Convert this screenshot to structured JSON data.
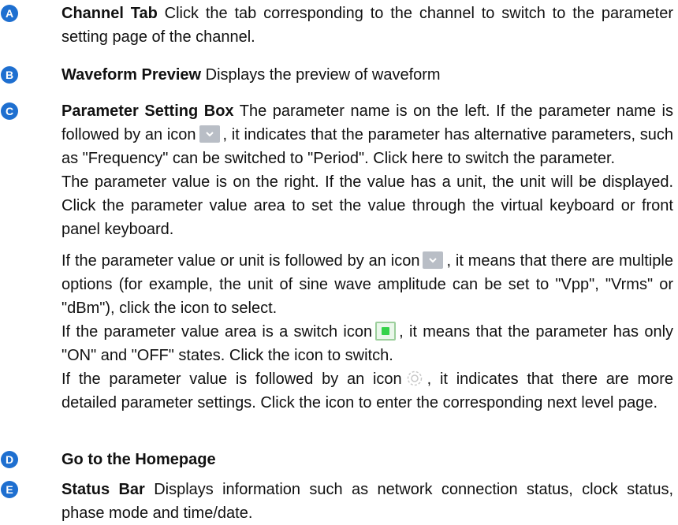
{
  "items": [
    {
      "marker": "A",
      "term": "Channel Tab",
      "text": "Click the tab corresponding to the channel to switch to the parameter setting page of the channel."
    },
    {
      "marker": "B",
      "term": "Waveform Preview",
      "text": "Displays the preview of waveform"
    },
    {
      "marker": "C",
      "term": "Parameter Setting Box",
      "text1_a": "The parameter name is on the left. If the parameter name is followed by an icon",
      "text1_b": ", it indicates that the parameter has alternative parameters, such as \"Frequency\" can be switched to \"Period\". Click here to switch the parameter.",
      "text2": "The parameter value is on the right. If the value has a unit, the unit will be displayed. Click the parameter value area to set the value through the virtual keyboard or front panel keyboard.",
      "text3_a": "If the parameter value or unit is followed by an icon",
      "text3_b": ", it means that there are multiple options (for example, the unit of sine wave amplitude can be set to \"Vpp\", \"Vrms\" or \"dBm\"), click the icon to select.",
      "text4_a": "If the parameter value area is a switch icon",
      "text4_b": ", it means that the parameter has only \"ON\" and \"OFF\" states. Click the icon to switch.",
      "text5_a": "If the parameter value is followed by an icon",
      "text5_b": ", it indicates that there are more detailed parameter settings. Click the icon to enter the corresponding next level page."
    },
    {
      "marker": "D",
      "term": "Go to the Homepage",
      "text": ""
    },
    {
      "marker": "E",
      "term": "Status Bar",
      "text": "Displays information such as network connection status, clock status, phase mode and time/date."
    }
  ],
  "icons": {
    "dropdown": "chevron-down-icon",
    "switch": "switch-icon",
    "settings": "gear-icon"
  },
  "colors": {
    "badge": "#1e6fd0",
    "dropdown_icon": "#b9bec6",
    "switch_on": "#35d24a"
  }
}
